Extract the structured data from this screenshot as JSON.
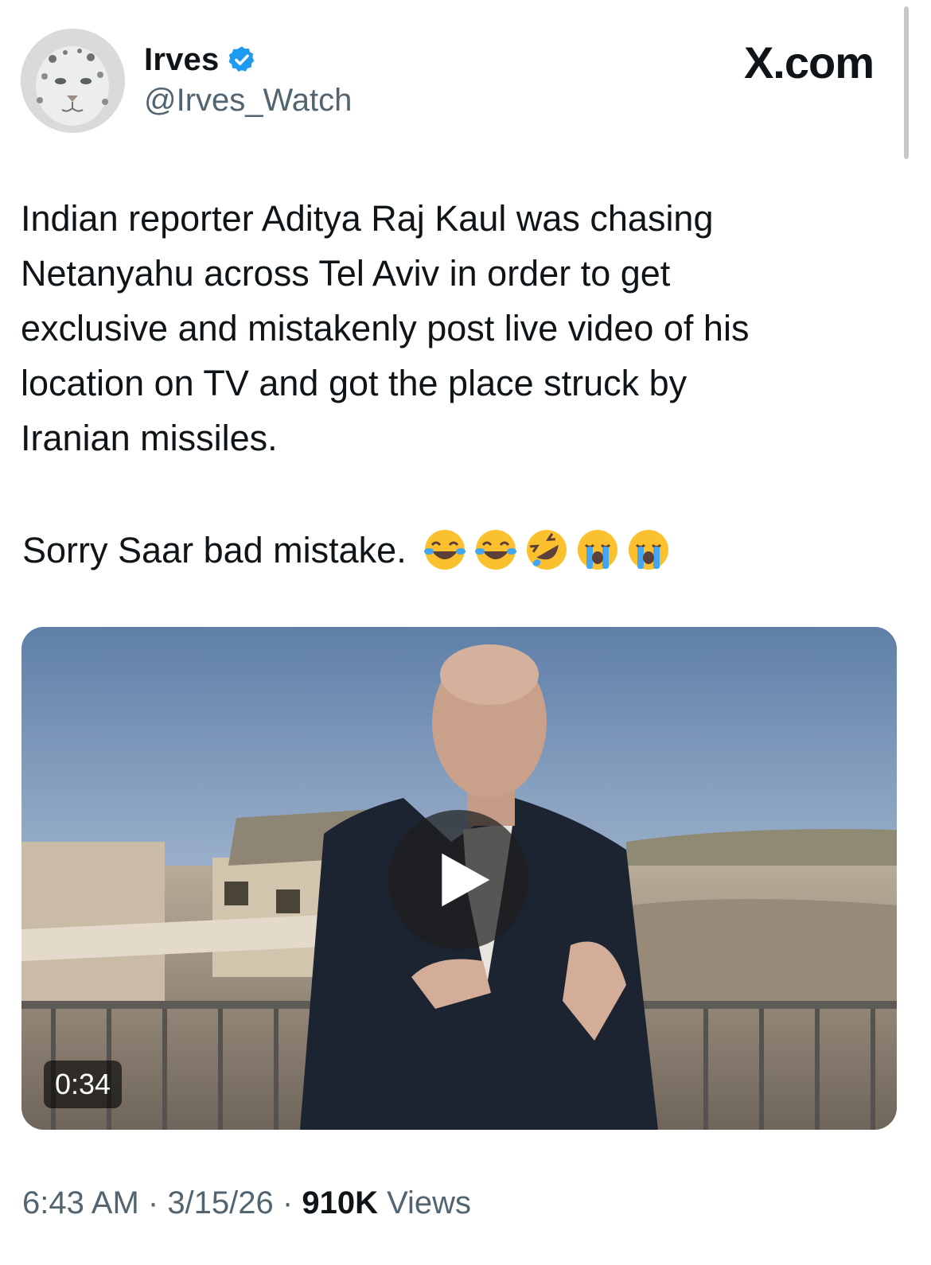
{
  "header": {
    "display_name": "Irves",
    "handle": "@Irves_Watch",
    "site_brand": "X.com"
  },
  "tweet": {
    "text": "Indian reporter Aditya Raj Kaul was chasing\nNetanyahu across Tel Aviv in order to get\nexclusive and mistakenly post live video of his\nlocation on TV and got the place struck by\nIranian missiles.",
    "closing": "Sorry Saar bad mistake. ",
    "emojis": [
      "tears-of-joy",
      "tears-of-joy",
      "rolling-on-floor-laughing",
      "loudly-crying",
      "loudly-crying"
    ]
  },
  "media": {
    "duration": "0:34"
  },
  "meta": {
    "time": "6:43 AM",
    "sep1": " · ",
    "date": "3/15/26",
    "sep2": " · ",
    "views_count": "910K",
    "views_label": " Views"
  },
  "colors": {
    "text": "#0f1419",
    "secondary": "#536471",
    "verified": "#1d9bf0"
  }
}
